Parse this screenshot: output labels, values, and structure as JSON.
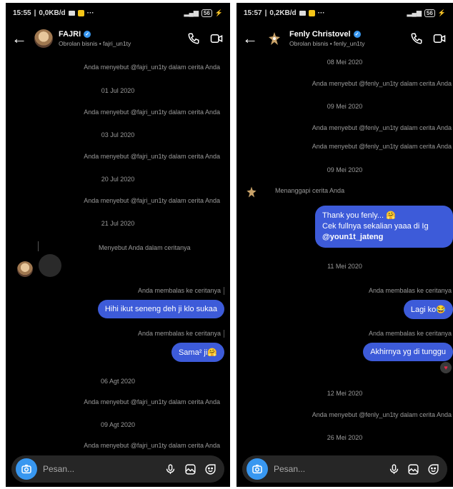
{
  "left": {
    "status": {
      "time": "15:55",
      "speed": "0,0KB/d",
      "battery": "56"
    },
    "header": {
      "name": "FAJRI",
      "subtitle": "Obrolan bisnis • fajri_un1ty"
    },
    "messages": [
      {
        "id": "l1",
        "text": "Anda menyebut @fajri_un1ty dalam cerita Anda"
      },
      {
        "id": "l2",
        "text": "01 Jul 2020"
      },
      {
        "id": "l3",
        "text": "Anda menyebut @fajri_un1ty dalam cerita Anda"
      },
      {
        "id": "l4",
        "text": "03 Jul 2020"
      },
      {
        "id": "l5",
        "text": "Anda menyebut @fajri_un1ty dalam cerita Anda"
      },
      {
        "id": "l6",
        "text": "20 Jul 2020"
      },
      {
        "id": "l7",
        "text": "Anda menyebut @fajri_un1ty dalam cerita Anda"
      },
      {
        "id": "l8",
        "text": "21 Jul 2020"
      },
      {
        "id": "l9",
        "text": "Menyebut Anda dalam ceritanya"
      },
      {
        "id": "l10",
        "text": "Anda membalas ke ceritanya"
      },
      {
        "id": "l11",
        "text": "Hihi ikut seneng deh ji klo sukaa"
      },
      {
        "id": "l12",
        "text": "Anda membalas ke ceritanya"
      },
      {
        "id": "l13",
        "text": "Sama² ji🤗"
      },
      {
        "id": "l14",
        "text": "06 Agt 2020"
      },
      {
        "id": "l15",
        "text": "Anda menyebut @fajri_un1ty dalam cerita Anda"
      },
      {
        "id": "l16",
        "text": "09 Agt 2020"
      },
      {
        "id": "l17",
        "text": "Anda menyebut @fajri_un1ty dalam cerita Anda"
      }
    ],
    "composer": {
      "placeholder": "Pesan..."
    }
  },
  "right": {
    "status": {
      "time": "15:57",
      "speed": "0,2KB/d",
      "battery": "56"
    },
    "header": {
      "name": "Fenly Christovel",
      "subtitle": "Obrolan bisnis • fenly_un1ty"
    },
    "messages": [
      {
        "id": "r1",
        "text": "08 Mei 2020"
      },
      {
        "id": "r2",
        "text": "Anda menyebut @fenly_un1ty dalam cerita Anda"
      },
      {
        "id": "r3",
        "text": "09 Mei 2020"
      },
      {
        "id": "r4",
        "text": "Anda menyebut @fenly_un1ty dalam cerita Anda"
      },
      {
        "id": "r5",
        "text": "Anda menyebut @fenly_un1ty dalam cerita Anda"
      },
      {
        "id": "r6",
        "text": "09 Mei 2020"
      },
      {
        "id": "r7",
        "text": "Menanggapi cerita Anda"
      },
      {
        "id": "r8a",
        "text": "Thank you fenly... 🤗"
      },
      {
        "id": "r8b",
        "text": "Cek fullnya sekalian yaaa di Ig"
      },
      {
        "id": "r8c",
        "text": "@youn1t_jateng"
      },
      {
        "id": "r9",
        "text": "11 Mei 2020"
      },
      {
        "id": "r10",
        "text": "Anda membalas ke ceritanya"
      },
      {
        "id": "r11",
        "text": "Lagi ko😂"
      },
      {
        "id": "r12",
        "text": "Anda membalas ke ceritanya"
      },
      {
        "id": "r13",
        "text": "Akhirnya yg di tunggu"
      },
      {
        "id": "r14",
        "text": "12 Mei 2020"
      },
      {
        "id": "r15",
        "text": "Anda menyebut @fenly_un1ty dalam cerita Anda"
      },
      {
        "id": "r16",
        "text": "26 Mei 2020"
      }
    ],
    "reaction": "♥",
    "composer": {
      "placeholder": "Pesan..."
    }
  },
  "colors": {
    "background": "#000000",
    "bubble": "#3d5bd9",
    "accent": "#3897f0",
    "reaction": "#e0294a"
  }
}
